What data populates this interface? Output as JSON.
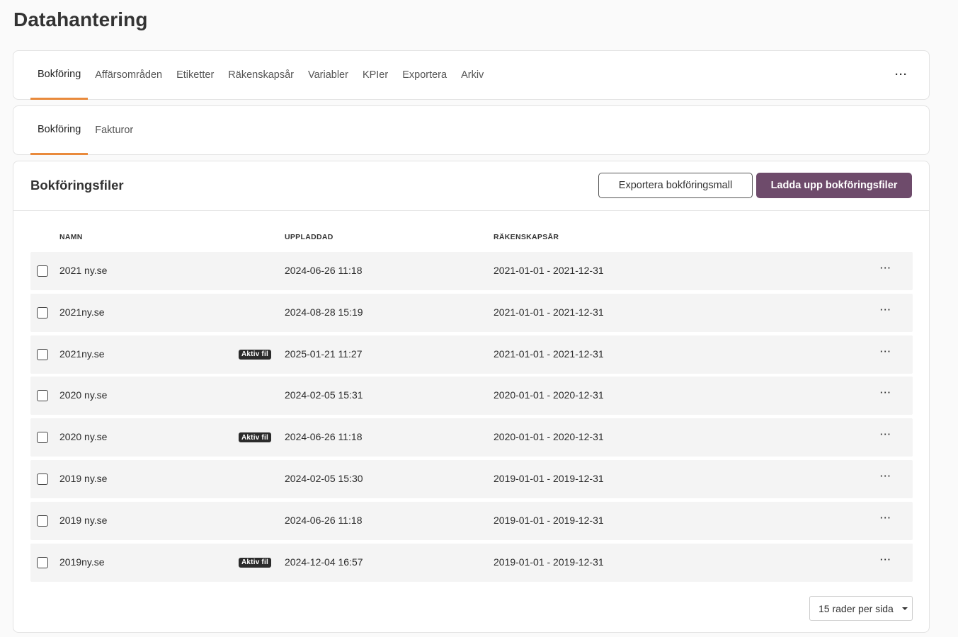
{
  "page": {
    "title": "Datahantering"
  },
  "main_tabs": [
    {
      "label": "Bokföring",
      "active": true
    },
    {
      "label": "Affärsområden",
      "active": false
    },
    {
      "label": "Etiketter",
      "active": false
    },
    {
      "label": "Räkenskapsår",
      "active": false
    },
    {
      "label": "Variabler",
      "active": false
    },
    {
      "label": "KPIer",
      "active": false
    },
    {
      "label": "Exportera",
      "active": false
    },
    {
      "label": "Arkiv",
      "active": false
    }
  ],
  "more_label": "···",
  "sub_tabs": [
    {
      "label": "Bokföring",
      "active": true
    },
    {
      "label": "Fakturor",
      "active": false
    }
  ],
  "files": {
    "title": "Bokföringsfiler",
    "export_label": "Exportera bokföringsmall",
    "upload_label": "Ladda upp bokföringsfiler",
    "columns": {
      "name": "NAMN",
      "uploaded": "UPPLADDAD",
      "fiscal_year": "RÄKENSKAPSÅR"
    },
    "rows": [
      {
        "name": "2021 ny.se",
        "badge": "",
        "uploaded": "2024-06-26 11:18",
        "fiscal_year": "2021-01-01 - 2021-12-31"
      },
      {
        "name": "2021ny.se",
        "badge": "",
        "uploaded": "2024-08-28 15:19",
        "fiscal_year": "2021-01-01 - 2021-12-31"
      },
      {
        "name": "2021ny.se",
        "badge": "Aktiv fil",
        "uploaded": "2025-01-21 11:27",
        "fiscal_year": "2021-01-01 - 2021-12-31"
      },
      {
        "name": "2020 ny.se",
        "badge": "",
        "uploaded": "2024-02-05 15:31",
        "fiscal_year": "2020-01-01 - 2020-12-31"
      },
      {
        "name": "2020 ny.se",
        "badge": "Aktiv fil",
        "uploaded": "2024-06-26 11:18",
        "fiscal_year": "2020-01-01 - 2020-12-31"
      },
      {
        "name": "2019 ny.se",
        "badge": "",
        "uploaded": "2024-02-05 15:30",
        "fiscal_year": "2019-01-01 - 2019-12-31"
      },
      {
        "name": "2019 ny.se",
        "badge": "",
        "uploaded": "2024-06-26 11:18",
        "fiscal_year": "2019-01-01 - 2019-12-31"
      },
      {
        "name": "2019ny.se",
        "badge": "Aktiv fil",
        "uploaded": "2024-12-04 16:57",
        "fiscal_year": "2019-01-01 - 2019-12-31"
      }
    ],
    "rows_per_page": "15 rader per sida"
  },
  "colors": {
    "accent": "#e98a3c",
    "primary": "#6e4b6b",
    "badge": "#2b2b2b",
    "row_bg": "#f4f4f4"
  }
}
